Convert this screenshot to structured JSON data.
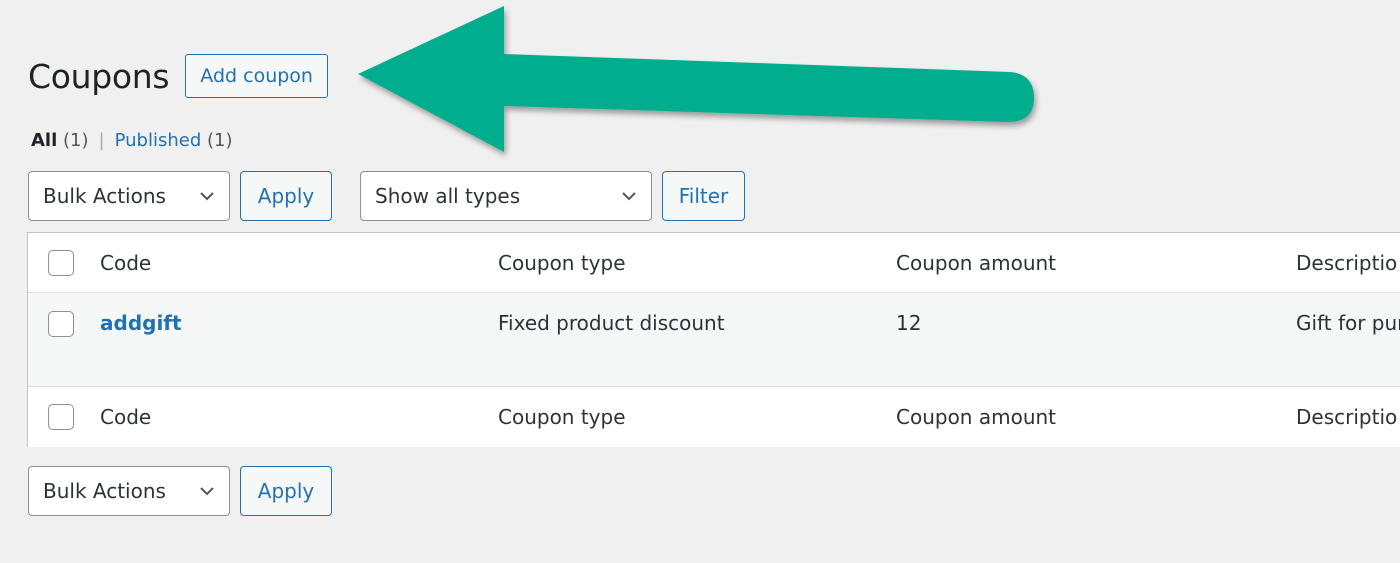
{
  "page": {
    "title": "Coupons",
    "add_button_label": "Add coupon"
  },
  "views": {
    "all_label": "All",
    "all_count": "(1)",
    "separator": "|",
    "published_label": "Published",
    "published_count": "(1)"
  },
  "top_nav": {
    "bulk_actions_selected": "Bulk Actions",
    "apply_label": "Apply",
    "type_filter_selected": "Show all types",
    "filter_label": "Filter"
  },
  "table": {
    "columns": [
      "Code",
      "Coupon type",
      "Coupon amount",
      "Descriptio"
    ],
    "rows": [
      {
        "code": "addgift",
        "coupon_type": "Fixed product discount",
        "coupon_amount": "12",
        "description": "Gift for pur"
      }
    ]
  },
  "bottom_nav": {
    "bulk_actions_selected": "Bulk Actions",
    "apply_label": "Apply"
  },
  "annotation": {
    "arrow_color": "#06ae8e",
    "arrow_direction": "left",
    "points_to": "Add coupon"
  },
  "colors": {
    "accent": "#2271b1",
    "background": "#f0f0f1"
  }
}
